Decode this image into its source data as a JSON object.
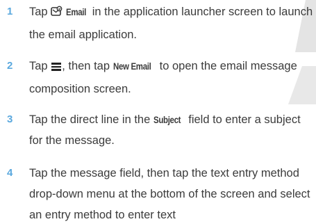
{
  "watermark": {
    "color": "#e2e2e2"
  },
  "accent_color": "#5aa8de",
  "steps": [
    {
      "number": "1",
      "pre": "Tap",
      "icon": "email-app-icon",
      "keyword": "Email",
      "post": "in the application launcher screen to launch the email application."
    },
    {
      "number": "2",
      "pre": "Tap",
      "icon": "menu-icon",
      "mid": ", then tap",
      "keyword": "New Email",
      "post": "to open the email message composition screen."
    },
    {
      "number": "3",
      "pre": "Tap the direct line in the",
      "keyword": "Subject",
      "post": "field to enter a subject for the message."
    },
    {
      "number": "4",
      "text": "Tap the message field, then tap the text entry method drop-down menu at the bottom of the screen and select an entry method to enter text"
    }
  ]
}
